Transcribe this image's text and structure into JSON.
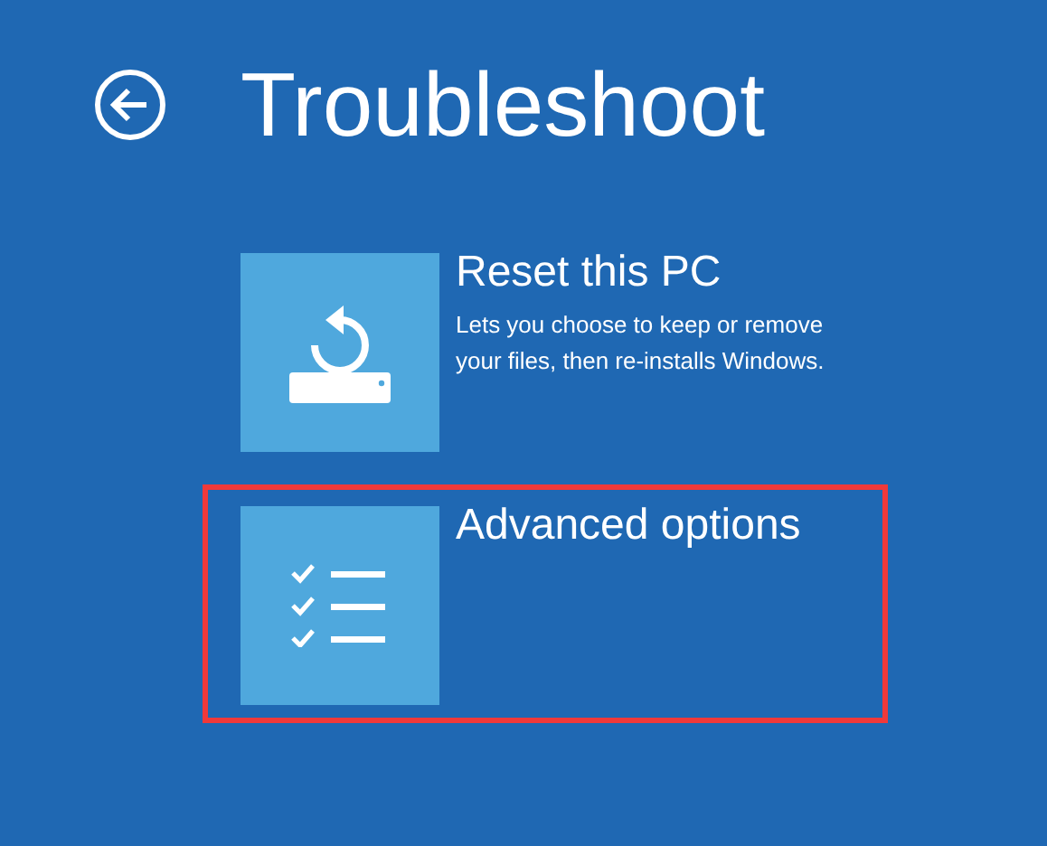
{
  "page": {
    "title": "Troubleshoot"
  },
  "options": [
    {
      "kind": "reset",
      "title": "Reset this PC",
      "description": "Lets you choose to keep or remove your files, then re-installs Windows.",
      "highlighted": false
    },
    {
      "kind": "checklist",
      "title": "Advanced options",
      "highlighted": true
    }
  ]
}
